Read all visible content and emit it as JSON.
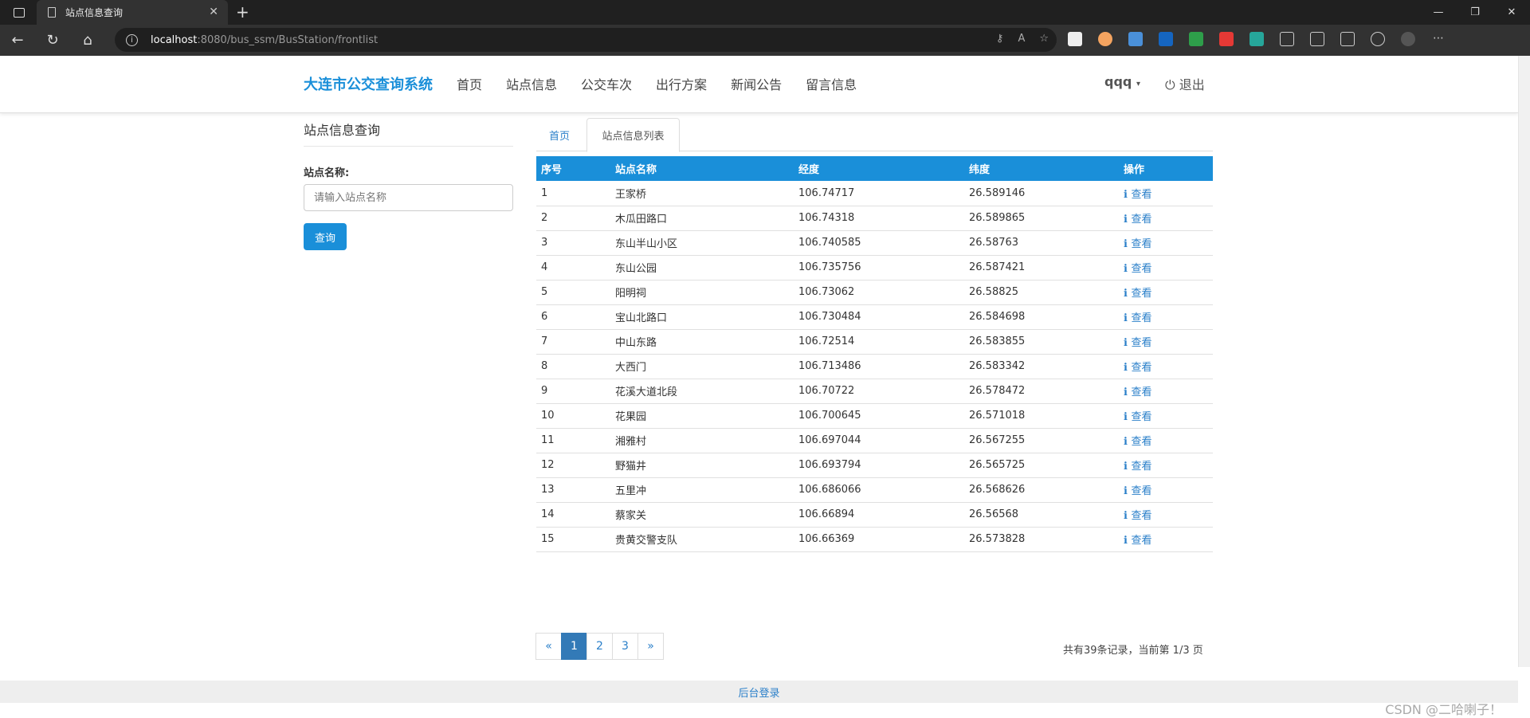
{
  "browser": {
    "tab_title": "站点信息查询",
    "url_host": "localhost",
    "url_rest": ":8080/bus_ssm/BusStation/frontlist"
  },
  "nav": {
    "brand": "大连市公交查询系统",
    "menu": [
      "首页",
      "站点信息",
      "公交车次",
      "出行方案",
      "新闻公告",
      "留言信息"
    ],
    "user": "qqq",
    "logout": "退出"
  },
  "sidebar": {
    "title": "站点信息查询",
    "label": "站点名称:",
    "placeholder": "请输入站点名称",
    "button": "查询"
  },
  "tabs": {
    "home": "首页",
    "list": "站点信息列表"
  },
  "table": {
    "headers": [
      "序号",
      "站点名称",
      "经度",
      "纬度",
      "操作"
    ],
    "rows": [
      [
        "1",
        "王家桥",
        "106.74717",
        "26.589146",
        "查看"
      ],
      [
        "2",
        "木瓜田路口",
        "106.74318",
        "26.589865",
        "查看"
      ],
      [
        "3",
        "东山半山小区",
        "106.740585",
        "26.58763",
        "查看"
      ],
      [
        "4",
        "东山公园",
        "106.735756",
        "26.587421",
        "查看"
      ],
      [
        "5",
        "阳明祠",
        "106.73062",
        "26.58825",
        "查看"
      ],
      [
        "6",
        "宝山北路口",
        "106.730484",
        "26.584698",
        "查看"
      ],
      [
        "7",
        "中山东路",
        "106.72514",
        "26.583855",
        "查看"
      ],
      [
        "8",
        "大西门",
        "106.713486",
        "26.583342",
        "查看"
      ],
      [
        "9",
        "花溪大道北段",
        "106.70722",
        "26.578472",
        "查看"
      ],
      [
        "10",
        "花果园",
        "106.700645",
        "26.571018",
        "查看"
      ],
      [
        "11",
        "湘雅村",
        "106.697044",
        "26.567255",
        "查看"
      ],
      [
        "12",
        "野猫井",
        "106.693794",
        "26.565725",
        "查看"
      ],
      [
        "13",
        "五里冲",
        "106.686066",
        "26.568626",
        "查看"
      ],
      [
        "14",
        "蔡家关",
        "106.66894",
        "26.56568",
        "查看"
      ],
      [
        "15",
        "贵黄交警支队",
        "106.66369",
        "26.573828",
        "查看"
      ]
    ]
  },
  "pagination": {
    "pages": [
      "«",
      "1",
      "2",
      "3",
      "»"
    ],
    "active": "1",
    "info": "共有39条记录，当前第 1/3 页"
  },
  "footer": {
    "link": "后台登录"
  },
  "watermark": "CSDN @二哈喇子！"
}
